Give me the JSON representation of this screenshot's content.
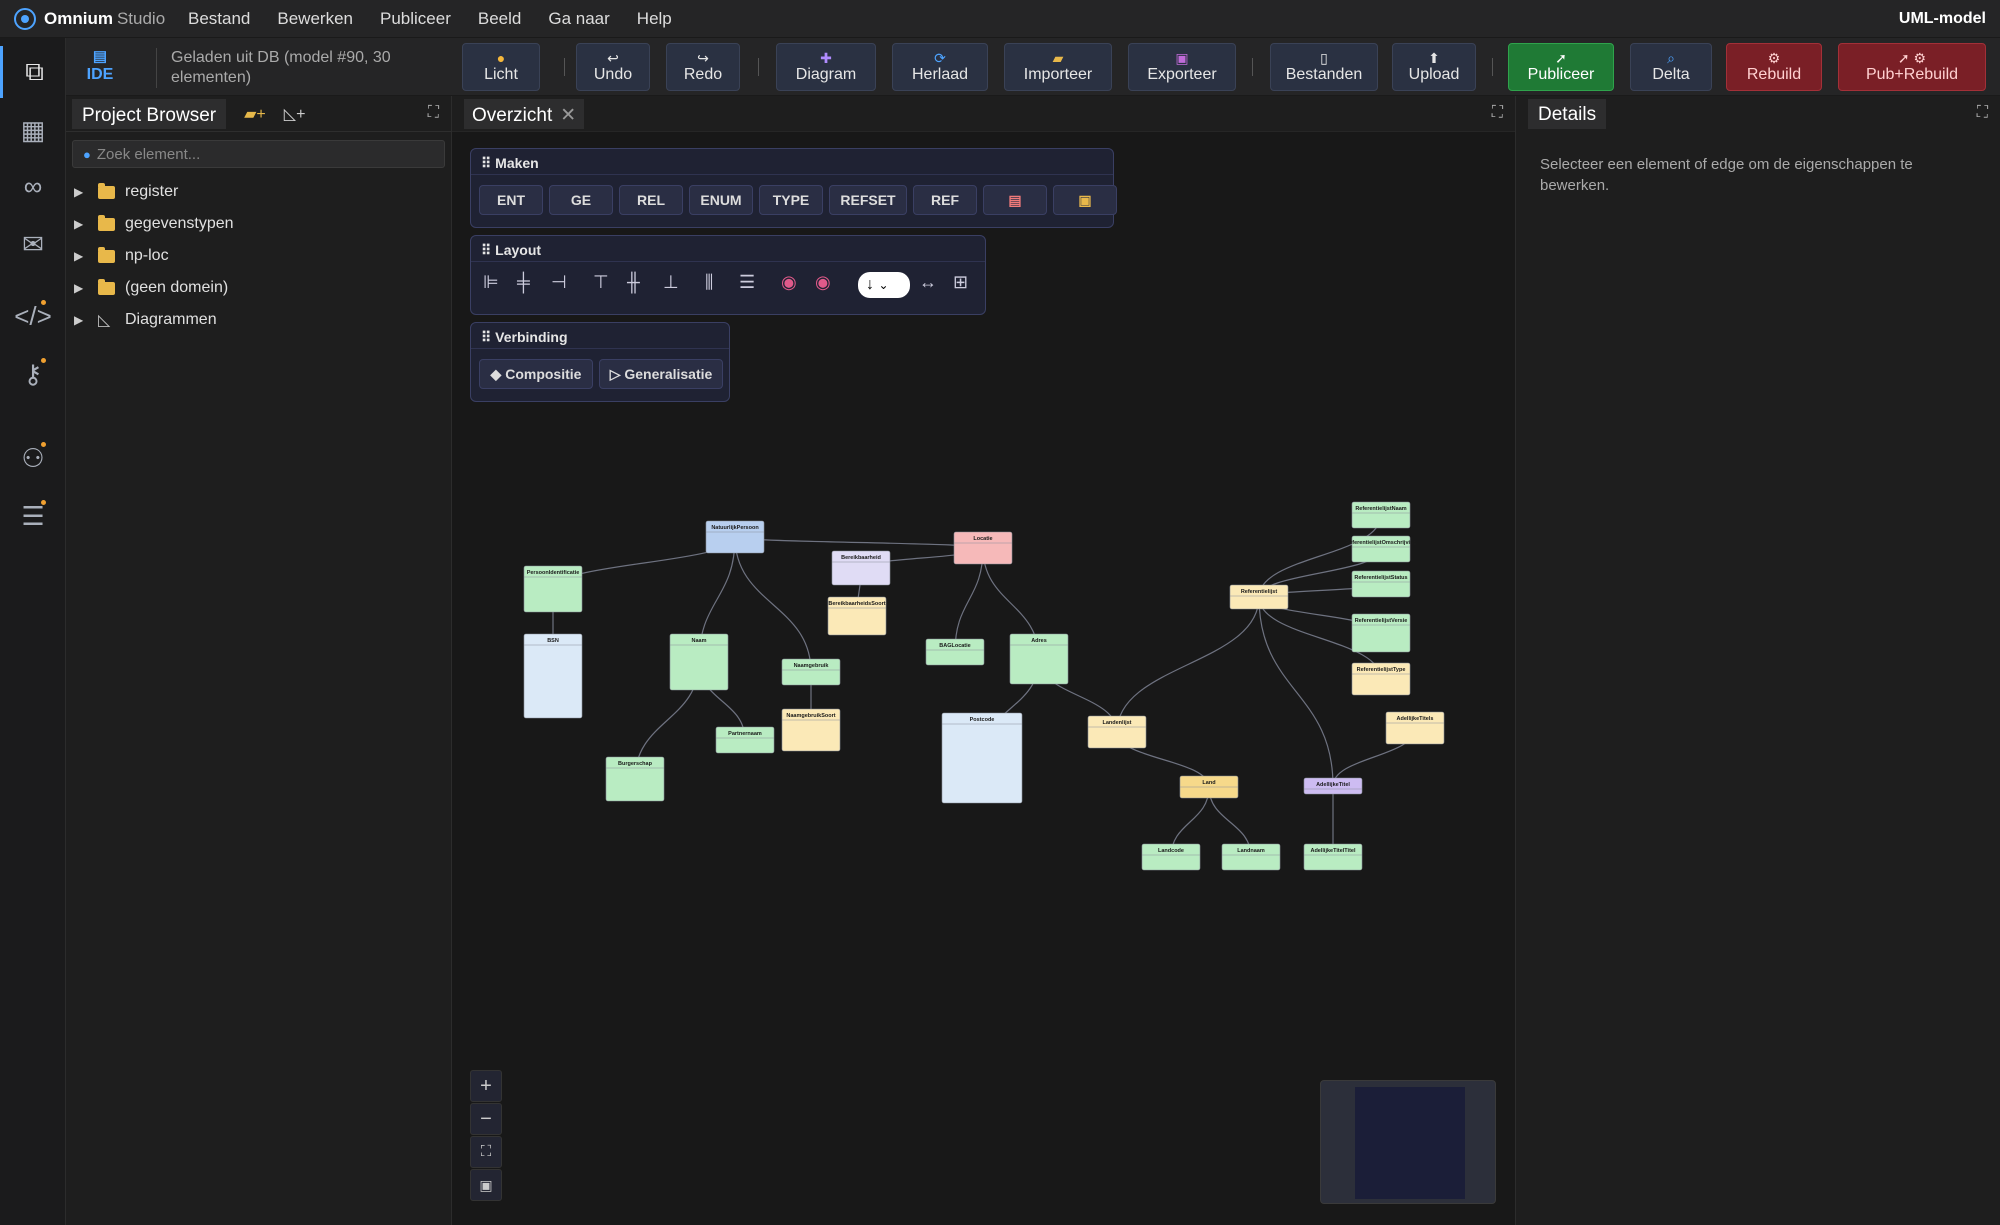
{
  "menubar": {
    "brand": "Omnium",
    "brand_suffix": "Studio",
    "menus": [
      "Bestand",
      "Bewerken",
      "Publiceer",
      "Beeld",
      "Ga naar",
      "Help"
    ],
    "model_label": "UML-model"
  },
  "toolbar": {
    "ide_label": "IDE",
    "db_info": "Geladen uit DB (model #90, 30 elementen)",
    "buttons": [
      {
        "label": "Licht",
        "icon": "sun-icon"
      },
      {
        "label": "Undo",
        "icon": "undo-icon"
      },
      {
        "label": "Redo",
        "icon": "redo-icon"
      },
      {
        "label": "Diagram",
        "icon": "plus-icon"
      },
      {
        "label": "Herlaad",
        "icon": "reload-icon"
      },
      {
        "label": "Importeer",
        "icon": "folder-icon"
      },
      {
        "label": "Exporteer",
        "icon": "save-icon"
      },
      {
        "label": "Bestanden",
        "icon": "files-icon"
      },
      {
        "label": "Upload",
        "icon": "upload-icon"
      },
      {
        "label": "Publiceer",
        "icon": "rocket-icon"
      },
      {
        "label": "Delta",
        "icon": "search-icon"
      },
      {
        "label": "Rebuild",
        "icon": "gear-icon"
      },
      {
        "label": "Pub+Rebuild",
        "icon": "rocket-gear-icon"
      }
    ]
  },
  "left": {
    "tab": "Project Browser",
    "search_placeholder": "Zoek element...",
    "tree": [
      "register",
      "gegevenstypen",
      "np-loc",
      "(geen domein)",
      "Diagrammen"
    ]
  },
  "center": {
    "tab": "Overzicht",
    "maken": {
      "title": "Maken",
      "buttons": [
        "ENT",
        "GE",
        "REL",
        "ENUM",
        "TYPE",
        "REFSET",
        "REF"
      ]
    },
    "layout": {
      "title": "Layout",
      "direction": "↓"
    },
    "verbinding": {
      "title": "Verbinding",
      "buttons": [
        "Compositie",
        "Generalisatie"
      ]
    },
    "nodes": [
      {
        "name": "NatuurlijkPersoon",
        "color": "#b8cfef"
      },
      {
        "name": "Locatie",
        "color": "#f6b9b9"
      },
      {
        "name": "Bereikbaarheid",
        "color": "#e0dcf5"
      },
      {
        "name": "BereikbaarheidsSoort",
        "color": "#fbe9b7"
      },
      {
        "name": "PersoonIdentificatie",
        "color": "#b9ecc2"
      },
      {
        "name": "BSN",
        "color": "#dbe9f7"
      },
      {
        "name": "Naam",
        "color": "#b9ecc2"
      },
      {
        "name": "Naamgebruik",
        "color": "#b9ecc2"
      },
      {
        "name": "NaamgebruikSoort",
        "color": "#fbe9b7"
      },
      {
        "name": "Partnernaam",
        "color": "#b9ecc2"
      },
      {
        "name": "Burgerschap",
        "color": "#b9ecc2"
      },
      {
        "name": "BAGLocatie",
        "color": "#b9ecc2"
      },
      {
        "name": "Adres",
        "color": "#b9ecc2"
      },
      {
        "name": "Postcode",
        "color": "#dbe9f7"
      },
      {
        "name": "Landenlijst",
        "color": "#fbe9b7"
      },
      {
        "name": "Land",
        "color": "#f6d98a"
      },
      {
        "name": "Landcode",
        "color": "#b9ecc2"
      },
      {
        "name": "Landnaam",
        "color": "#b9ecc2"
      },
      {
        "name": "Referentielijst",
        "color": "#fbe9b7"
      },
      {
        "name": "ReferentielijstNaam",
        "color": "#b9ecc2"
      },
      {
        "name": "ReferentielijstOmschrijving",
        "color": "#b9ecc2"
      },
      {
        "name": "ReferentielijstStatus",
        "color": "#b9ecc2"
      },
      {
        "name": "ReferentielijstVersie",
        "color": "#b9ecc2"
      },
      {
        "name": "ReferentielijstType",
        "color": "#fbe9b7"
      },
      {
        "name": "AdellijkeTitels",
        "color": "#fbe9b7"
      },
      {
        "name": "AdellijkeTitel",
        "color": "#cdbcf2"
      },
      {
        "name": "AdellijkeTitelTitel",
        "color": "#b9ecc2"
      }
    ]
  },
  "right": {
    "tab": "Details",
    "message": "Selecteer een element of edge om de eigenschappen te bewerken."
  }
}
